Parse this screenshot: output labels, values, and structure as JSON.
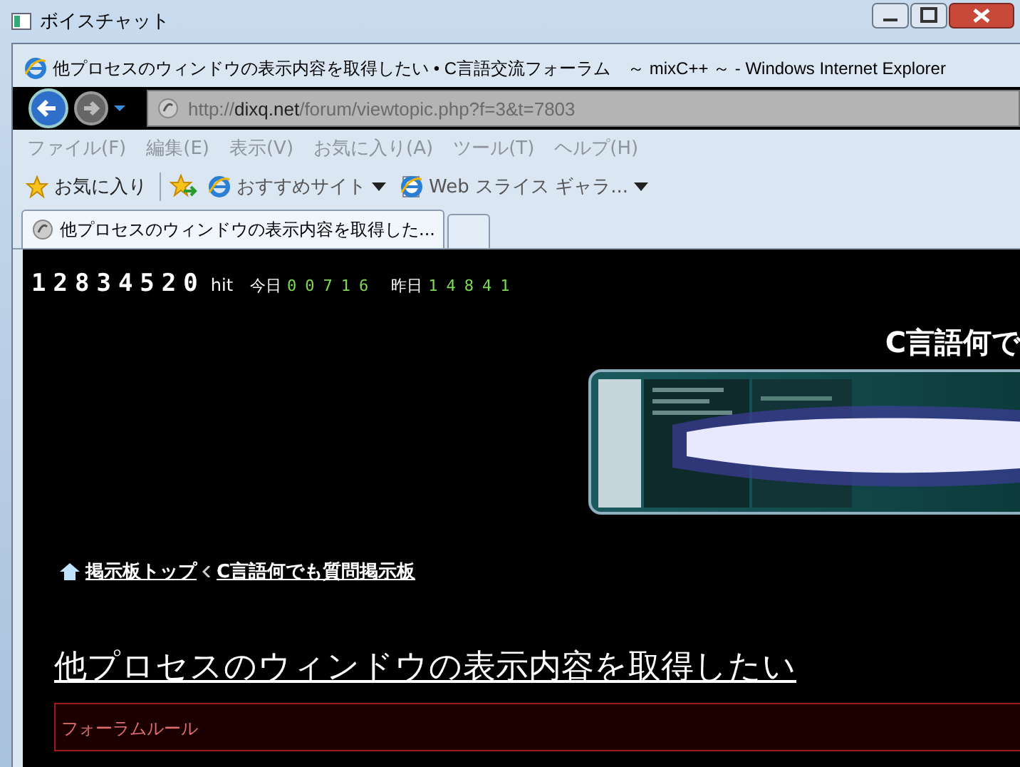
{
  "outer_window": {
    "title": "ボイスチャット"
  },
  "browser": {
    "title": "他プロセスのウィンドウの表示内容を取得したい • C言語交流フォーラム　～ mixC++ ～ - Windows Internet Explorer",
    "address": {
      "prefix": "http://",
      "domain": "dixq.net",
      "path": "/forum/viewtopic.php?f=3&t=7803"
    },
    "menu": [
      "ファイル(F)",
      "編集(E)",
      "表示(V)",
      "お気に入り(A)",
      "ツール(T)",
      "ヘルプ(H)"
    ],
    "favorites": [
      {
        "kind": "favorites",
        "label": "お気に入り"
      },
      {
        "kind": "dropdown",
        "label": "おすすめサイト"
      },
      {
        "kind": "dropdown",
        "label": "Web スライス ギャラ..."
      }
    ],
    "tabs": [
      {
        "label": "他プロセスのウィンドウの表示内容を取得した...",
        "selected": true
      }
    ]
  },
  "page": {
    "counter": {
      "total": "12834520",
      "unit": "hit",
      "today_label": "今日",
      "today": "00716",
      "yesterday_label": "昨日",
      "yesterday": "14841"
    },
    "site_heading": "C言語何で",
    "banner": {
      "kind": "picture"
    },
    "breadcrumbs": [
      "掲示板トップ",
      "C言語何でも質問掲示板"
    ],
    "topic_title": "他プロセスのウィンドウの表示内容を取得したい",
    "rules_box": {
      "title": "フォーラムルール"
    }
  }
}
